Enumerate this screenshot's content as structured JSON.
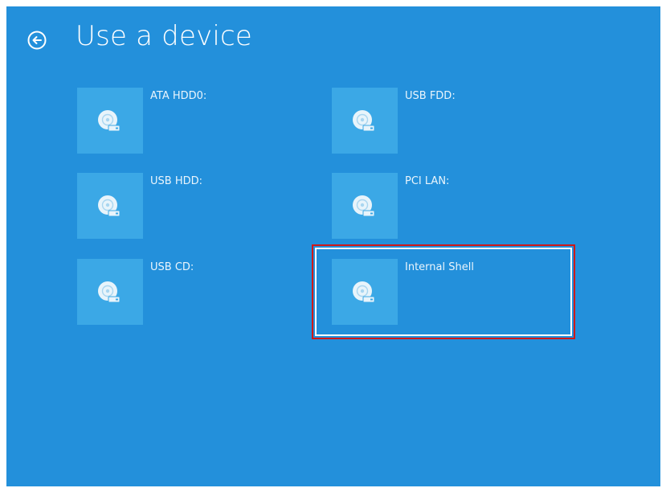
{
  "header": {
    "title": "Use a device",
    "back_icon": "back-arrow-circle-icon"
  },
  "devices": [
    {
      "label": "ATA HDD0:",
      "icon": "disk-drive-icon"
    },
    {
      "label": "USB FDD:",
      "icon": "disk-drive-icon"
    },
    {
      "label": "USB HDD:",
      "icon": "disk-drive-icon"
    },
    {
      "label": "PCI LAN:",
      "icon": "disk-drive-icon"
    },
    {
      "label": "USB CD:",
      "icon": "disk-drive-icon"
    },
    {
      "label": "Internal Shell",
      "icon": "disk-drive-icon",
      "selected": true
    }
  ],
  "colors": {
    "background": "#2390db",
    "tile": "#3ba8e6",
    "selection_outer": "#d01818",
    "selection_inner": "#ffffff"
  }
}
